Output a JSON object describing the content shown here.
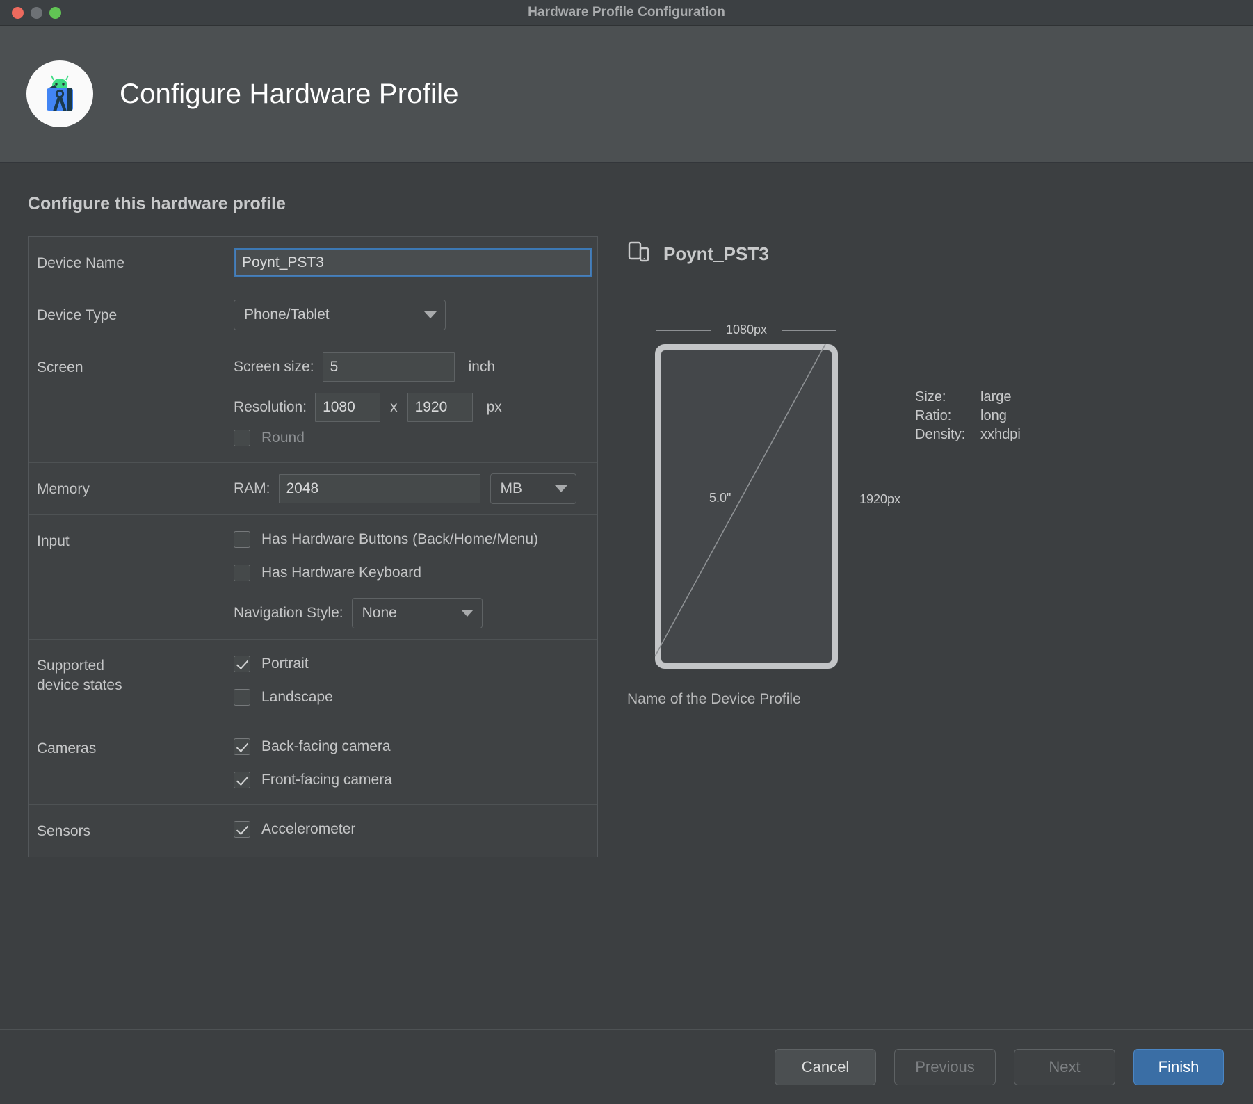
{
  "window": {
    "title": "Hardware Profile Configuration",
    "traffic_lights": [
      "close",
      "minimize",
      "zoom"
    ]
  },
  "header": {
    "title": "Configure Hardware Profile",
    "logo_icon": "android-studio-icon"
  },
  "main": {
    "section_title": "Configure this hardware profile",
    "rows": {
      "device_name": {
        "label": "Device Name",
        "value": "Poynt_PST3",
        "placeholder": ""
      },
      "device_type": {
        "label": "Device Type",
        "value": "Phone/Tablet"
      },
      "screen": {
        "label": "Screen",
        "screen_size_label": "Screen size:",
        "screen_size_value": "5",
        "screen_size_unit": "inch",
        "resolution_label": "Resolution:",
        "resolution_width": "1080",
        "resolution_separator": "x",
        "resolution_height": "1920",
        "resolution_unit": "px",
        "round_label": "Round",
        "round_checked": false
      },
      "memory": {
        "label": "Memory",
        "ram_label": "RAM:",
        "ram_value": "2048",
        "ram_unit": "MB"
      },
      "input": {
        "label": "Input",
        "hardware_buttons_label": "Has Hardware Buttons (Back/Home/Menu)",
        "hardware_buttons_checked": false,
        "hardware_keyboard_label": "Has Hardware Keyboard",
        "hardware_keyboard_checked": false,
        "navigation_style_label": "Navigation Style:",
        "navigation_style_value": "None"
      },
      "device_states": {
        "label": "Supported\ndevice states",
        "label_line1": "Supported",
        "label_line2": "device states",
        "portrait_label": "Portrait",
        "portrait_checked": true,
        "landscape_label": "Landscape",
        "landscape_checked": false
      },
      "cameras": {
        "label": "Cameras",
        "back_label": "Back-facing camera",
        "back_checked": true,
        "front_label": "Front-facing camera",
        "front_checked": true
      },
      "sensors": {
        "label": "Sensors",
        "accelerometer_label": "Accelerometer",
        "accelerometer_checked": true
      }
    }
  },
  "preview": {
    "icon": "device-preview-icon",
    "title": "Poynt_PST3",
    "width_label": "1080px",
    "height_label": "1920px",
    "diagonal_label": "5.0\"",
    "specs": [
      {
        "key": "Size:",
        "value": "large"
      },
      {
        "key": "Ratio:",
        "value": "long"
      },
      {
        "key": "Density:",
        "value": "xxhdpi"
      }
    ],
    "footnote": "Name of the Device Profile"
  },
  "footer": {
    "cancel_label": "Cancel",
    "previous_label": "Previous",
    "next_label": "Next",
    "finish_label": "Finish"
  },
  "colors": {
    "accent": "#3a6ea5",
    "focus_border": "#3c78b4",
    "background": "#3c3f41",
    "header_band": "#4c5052"
  }
}
